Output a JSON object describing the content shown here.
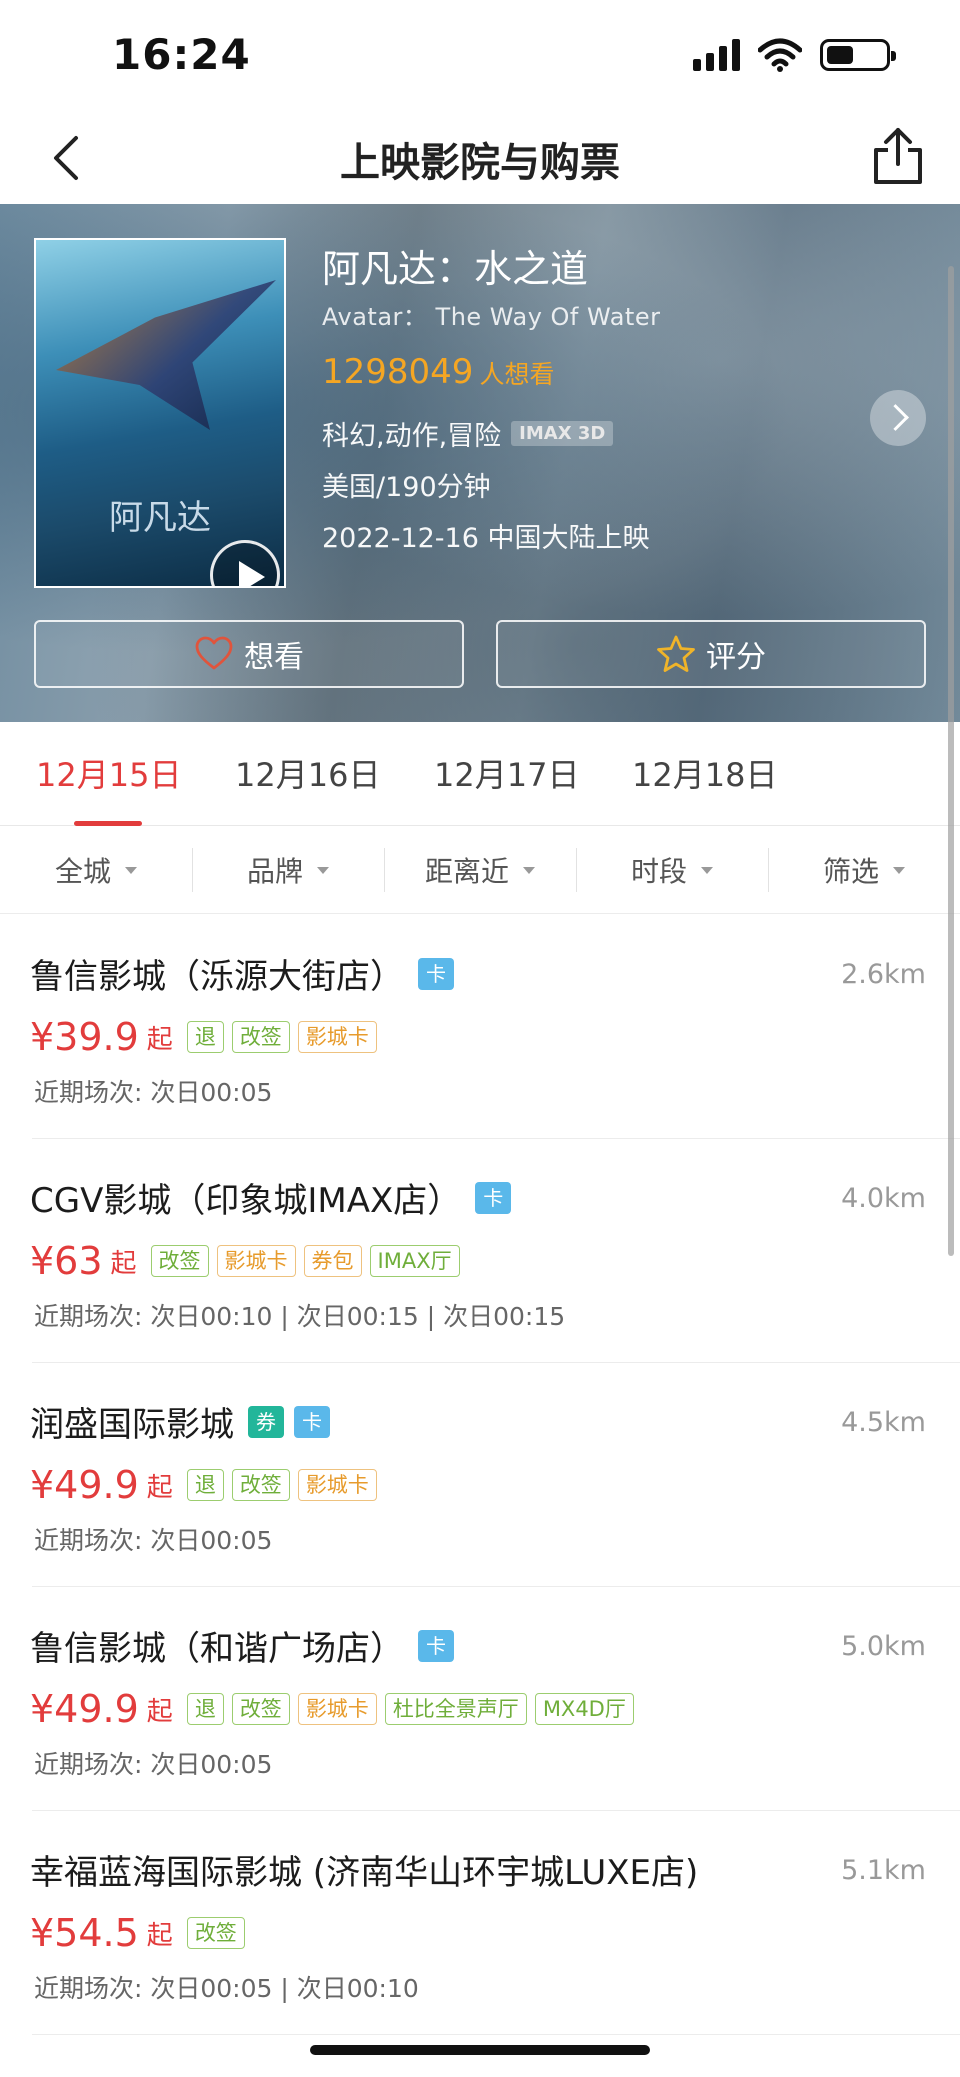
{
  "status_bar": {
    "time": "16:24"
  },
  "nav": {
    "title": "上映影院与购票"
  },
  "movie": {
    "poster_title": "阿凡达",
    "title": "阿凡达：水之道",
    "en_title": "Avatar： The Way Of Water",
    "want_count": "1298049",
    "want_suffix": "人想看",
    "genres": "科幻,动作,冒险",
    "format_tag": "IMAX 3D",
    "country_duration": "美国/190分钟",
    "release": "2022-12-16 中国大陆上映"
  },
  "actions": {
    "want_label": "想看",
    "rate_label": "评分"
  },
  "dates": [
    {
      "label": "12月15日",
      "active": true
    },
    {
      "label": "12月16日",
      "active": false
    },
    {
      "label": "12月17日",
      "active": false
    },
    {
      "label": "12月18日",
      "active": false
    }
  ],
  "filters": [
    "全城",
    "品牌",
    "距离近",
    "时段",
    "筛选"
  ],
  "price_suffix": "起",
  "cinemas": [
    {
      "name": "鲁信影城（泺源大街店）",
      "badges": [
        "卡"
      ],
      "distance": "2.6km",
      "price": "¥39.9",
      "tags": [
        "退",
        "改签",
        "影城卡"
      ],
      "showtimes": "近期场次: 次日00:05"
    },
    {
      "name": "CGV影城（印象城IMAX店）",
      "badges": [
        "卡"
      ],
      "distance": "4.0km",
      "price": "¥63",
      "tags": [
        "改签",
        "影城卡",
        "券包",
        "IMAX厅"
      ],
      "showtimes": "近期场次: 次日00:10 | 次日00:15 | 次日00:15"
    },
    {
      "name": "润盛国际影城",
      "badges": [
        "券",
        "卡"
      ],
      "distance": "4.5km",
      "price": "¥49.9",
      "tags": [
        "退",
        "改签",
        "影城卡"
      ],
      "showtimes": "近期场次: 次日00:05"
    },
    {
      "name": "鲁信影城（和谐广场店）",
      "badges": [
        "卡"
      ],
      "distance": "5.0km",
      "price": "¥49.9",
      "tags": [
        "退",
        "改签",
        "影城卡",
        "杜比全景声厅",
        "MX4D厅"
      ],
      "showtimes": "近期场次: 次日00:05"
    },
    {
      "name": "幸福蓝海国际影城 (济南华山环宇城LUXE店)",
      "badges": [],
      "distance": "5.1km",
      "price": "¥54.5",
      "tags": [
        "改签"
      ],
      "showtimes": "近期场次: 次日00:05 | 次日00:10"
    }
  ]
}
